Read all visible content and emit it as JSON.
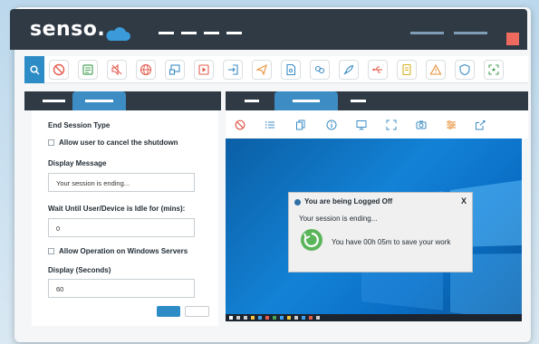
{
  "app": {
    "logo_text": "senso."
  },
  "toolbar": {
    "icons": [
      "search-icon",
      "prohibit-icon",
      "list-card-icon",
      "mute-icon",
      "globe-icon",
      "chat-screen-icon",
      "play-icon",
      "login-icon",
      "send-icon",
      "file-icon",
      "link-icon",
      "rocket-icon",
      "usb-icon",
      "document-icon",
      "warning-icon",
      "shield-icon",
      "scan-icon"
    ]
  },
  "form": {
    "end_session_type_label": "End Session Type",
    "allow_cancel_label": "Allow user to cancel the shutdown",
    "display_message_label": "Display Message",
    "display_message_value": "Your session is ending...",
    "wait_idle_label": "Wait Until User/Device is Idle for (mins):",
    "wait_idle_value": "0",
    "allow_windows_servers_label": "Allow Operation on Windows Servers",
    "display_seconds_label": "Display (Seconds)",
    "display_seconds_value": "60"
  },
  "preview": {
    "toolbar_icons": [
      "prohibit-icon",
      "checklist-icon",
      "copy-icon",
      "info-icon",
      "monitor-icon",
      "expand-icon",
      "camera-icon",
      "sliders-icon",
      "share-icon"
    ],
    "dialog": {
      "title": "You are being Logged Off",
      "close_label": "X",
      "message": "Your session is ending...",
      "countdown": "You have 00h 05m to save your work"
    }
  },
  "colors": {
    "titlebar": "#2f3a45",
    "accent": "#2d8bc5",
    "close": "#ef6a5e",
    "spinner": "#5bb55b"
  }
}
